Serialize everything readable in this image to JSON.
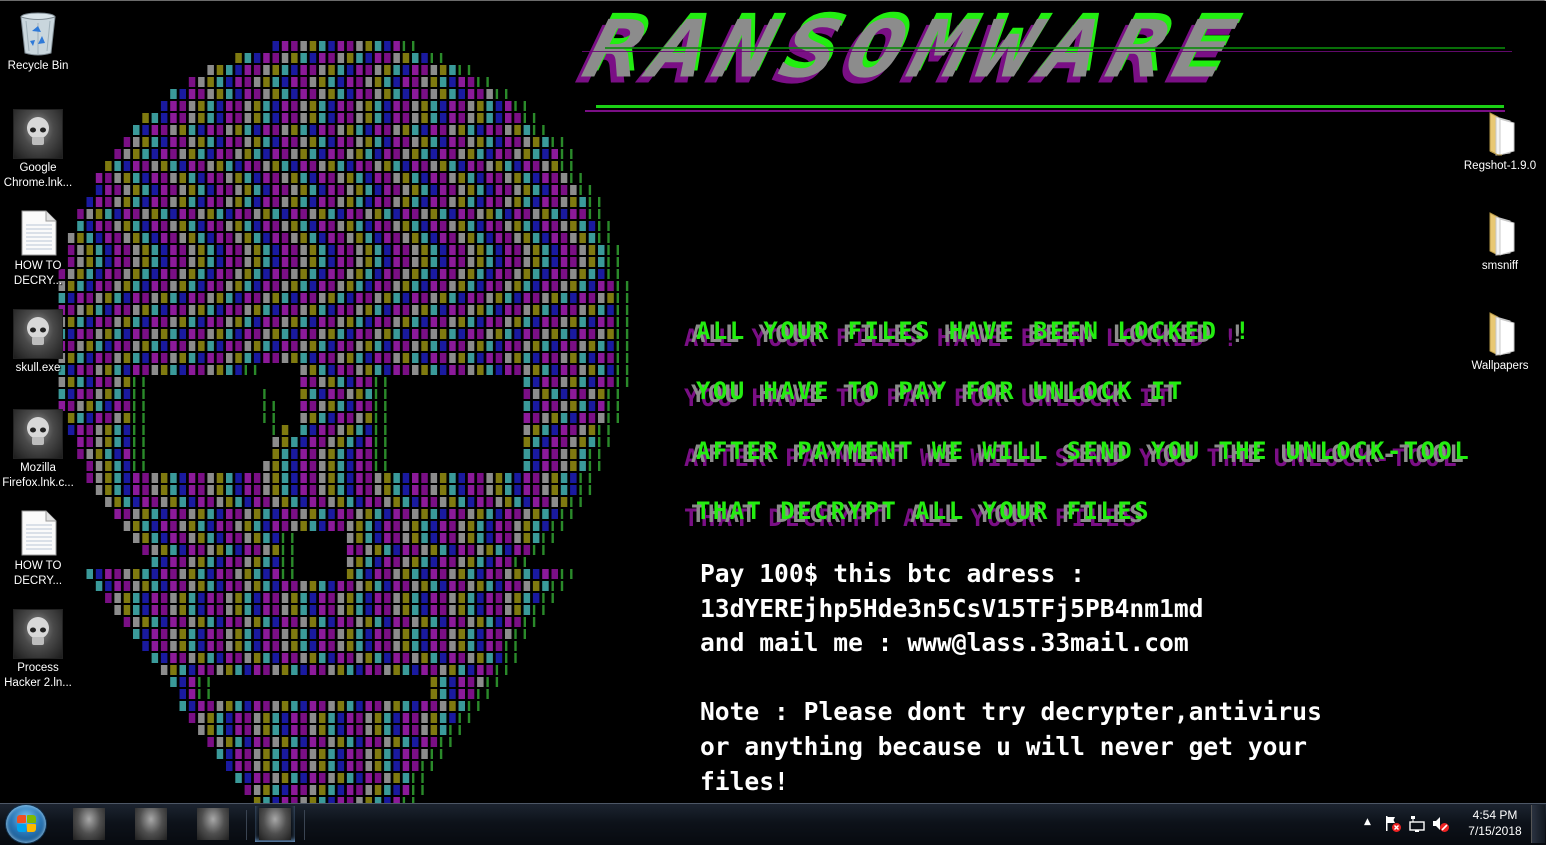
{
  "desktop": {
    "left_icons": [
      {
        "label": "Recycle Bin",
        "icon": "recycle-bin-icon"
      },
      {
        "label": "Google\nChrome.lnk...",
        "icon": "skull-shortcut-icon"
      },
      {
        "label": "HOW TO\nDECRY...",
        "icon": "text-document-icon"
      },
      {
        "label": "skull.exe",
        "icon": "skull-shortcut-icon"
      },
      {
        "label": "Mozilla\nFirefox.lnk.c...",
        "icon": "skull-shortcut-icon"
      },
      {
        "label": "HOW TO\nDECRY...",
        "icon": "text-document-icon"
      },
      {
        "label": "Process\nHacker 2.ln...",
        "icon": "skull-shortcut-icon"
      }
    ],
    "right_icons": [
      {
        "label": "Regshot-1.9.0",
        "icon": "folder-icon"
      },
      {
        "label": "smsniff",
        "icon": "folder-icon"
      },
      {
        "label": "Wallpapers",
        "icon": "folder-icon"
      }
    ]
  },
  "wallpaper": {
    "title": "RANSOMWARE",
    "glitch_lines": [
      "ALL YOUR FILES HAVE BEEN LOCKED !",
      "YOU HAVE TO PAY FOR UNLOCK IT",
      "AFTER PAYMENT WE WILL SEND YOU THE UNLOCK-TOOL",
      "THAT DECRYPT ALL YOUR FILES"
    ],
    "note": "Pay 100$ this btc adress :\n13dYEREjhp5Hde3n5CsV15TFj5PB4nm1md\nand mail me : www@lass.33mail.com\n\nNote : Please dont try decrypter,antivirus\nor anything because u will never get your\nfiles!",
    "payment": {
      "amount": "100$",
      "btc_address": "13dYEREjhp5Hde3n5CsV15TFj5PB4nm1md",
      "email": "www@lass.33mail.com"
    },
    "colors": {
      "green": "#22ee11",
      "purple": "#7a0f85",
      "gray": "#8c8c8c",
      "background": "#000000"
    }
  },
  "taskbar": {
    "start_button": "start-button",
    "pinned": [
      {
        "icon": "skull-app-icon"
      },
      {
        "icon": "skull-app-icon"
      },
      {
        "icon": "skull-app-icon"
      },
      {
        "icon": "skull-app-icon"
      }
    ],
    "tray": {
      "show_hidden": "▲",
      "icons": [
        "action-center-flag-icon",
        "network-icon",
        "volume-muted-icon"
      ]
    },
    "clock": {
      "time": "4:54 PM",
      "date": "7/15/2018"
    }
  }
}
